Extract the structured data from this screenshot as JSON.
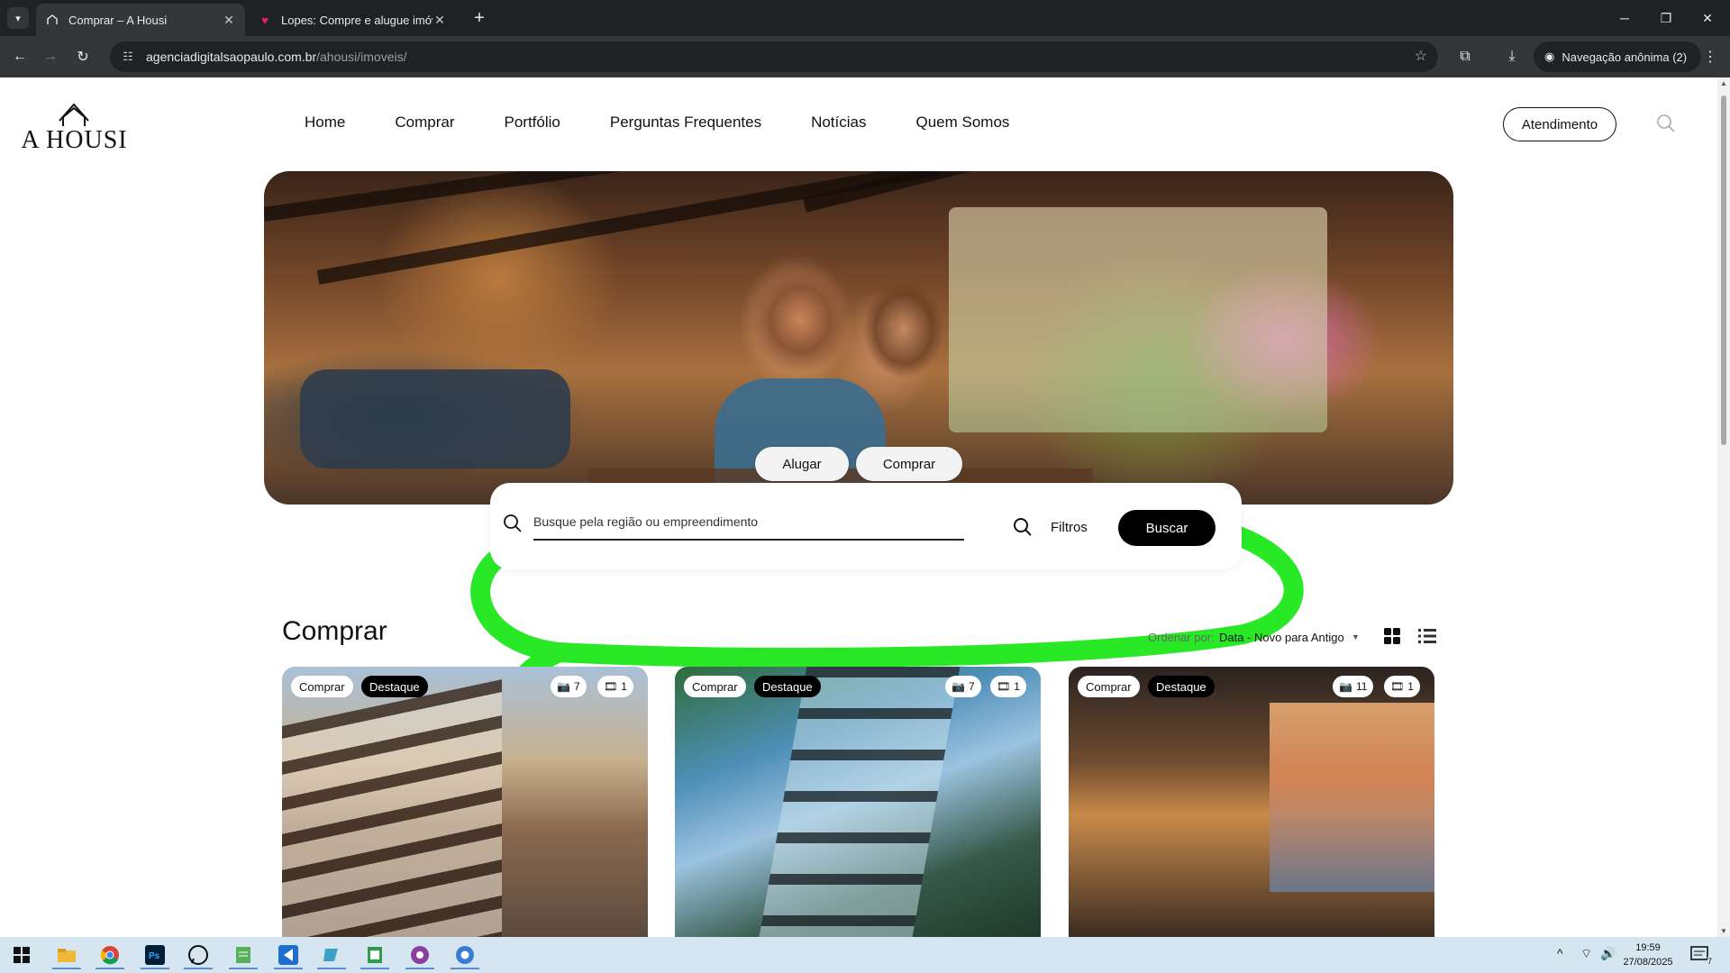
{
  "browser": {
    "tabs": [
      {
        "title": "Comprar – A Housi",
        "active": true,
        "icon": "housi-logo-icon"
      },
      {
        "title": "Lopes: Compre e alugue imóve",
        "active": false,
        "icon": "heart-icon"
      }
    ],
    "url_host": "agenciadigitalsaopaulo.com.br",
    "url_path": "/ahousi/imoveis/",
    "incognito_label": "Navegação anônima (2)"
  },
  "site": {
    "logo_text": "A HOUSI",
    "nav": [
      "Home",
      "Comprar",
      "Portfólio",
      "Perguntas Frequentes",
      "Notícias",
      "Quem Somos"
    ],
    "cta": "Atendimento"
  },
  "search": {
    "mode_rent": "Alugar",
    "mode_buy": "Comprar",
    "placeholder": "Busque pela região ou empreendimento",
    "filters_label": "Filtros",
    "submit_label": "Buscar",
    "highlight_color": "#1ee81a"
  },
  "listing": {
    "title": "Comprar",
    "sort_label": "Ordenar por:",
    "sort_value": "Data - Novo para Antigo",
    "cards": [
      {
        "tag": "Comprar",
        "featured": "Destaque",
        "photos": "7",
        "videos": "1"
      },
      {
        "tag": "Comprar",
        "featured": "Destaque",
        "photos": "7",
        "videos": "1"
      },
      {
        "tag": "Comprar",
        "featured": "Destaque",
        "photos": "11",
        "videos": "1"
      }
    ]
  },
  "taskbar": {
    "apps": [
      "windows-start-icon",
      "file-explorer-icon",
      "chrome-icon",
      "photoshop-icon",
      "whatsapp-icon",
      "notepad-icon",
      "vscode-icon",
      "app-icon",
      "sheet-icon",
      "app-icon",
      "chrome-icon"
    ],
    "time": "19:59",
    "date": "27/08/2025",
    "notifications": "7"
  }
}
